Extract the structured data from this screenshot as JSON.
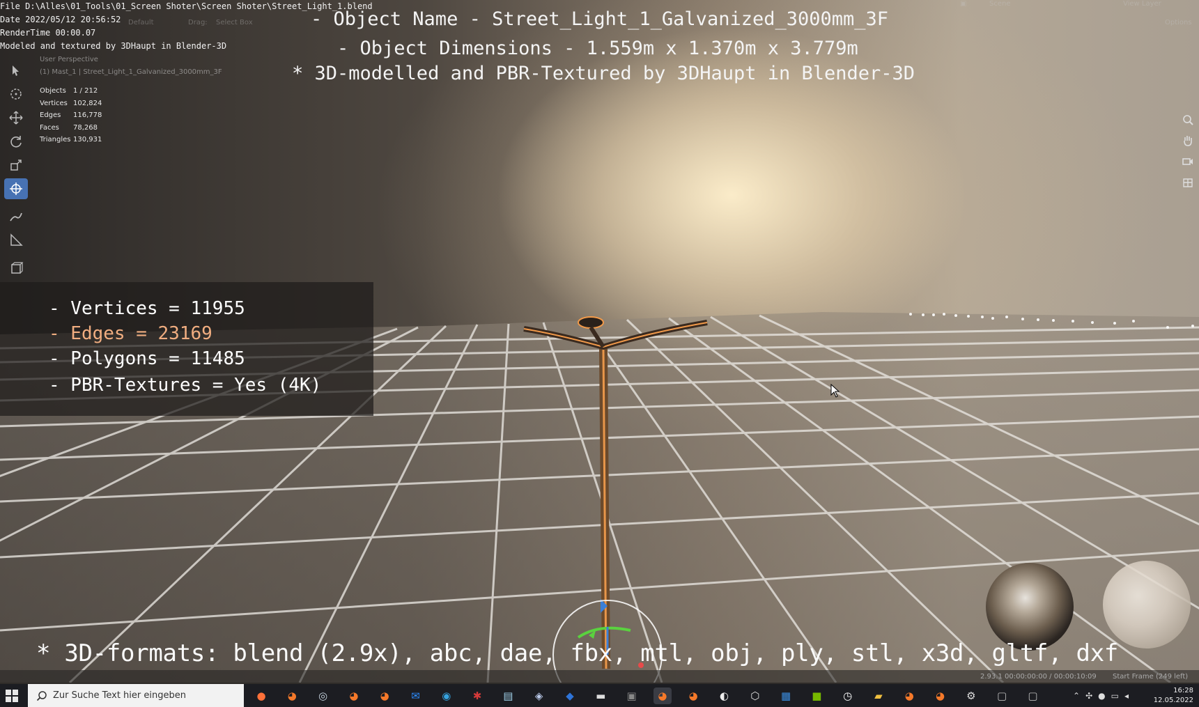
{
  "meta": {
    "file": "File D:\\Alles\\01_Tools\\01_Screen Shoter\\Screen Shoter\\Street_Light_1.blend",
    "date": "Date 2022/05/12 20:56:52",
    "render_time": "RenderTime 00:00.07",
    "credit": "Modeled and textured by 3DHaupt in Blender-3D"
  },
  "title_overlay": {
    "line1": "- Object Name - Street_Light_1_Galvanized_3000mm_3F",
    "line2": "- Object Dimensions -  1.559m x 1.370m x 3.779m",
    "line3": "* 3D-modelled and PBR-Textured by 3DHaupt in Blender-3D"
  },
  "header": {
    "scene": "Scene",
    "view_layer": "View Layer",
    "orientation": "Default",
    "drag_label": "Drag:",
    "drag_value": "Select Box",
    "options": "Options"
  },
  "viewport": {
    "perspective": "User Perspective",
    "active_object": "(1) Mast_1 | Street_Light_1_Galvanized_3000mm_3F"
  },
  "stats": [
    {
      "label": "Objects",
      "value": "1 / 212"
    },
    {
      "label": "Vertices",
      "value": "102,824"
    },
    {
      "label": "Edges",
      "value": "116,778"
    },
    {
      "label": "Faces",
      "value": "78,268"
    },
    {
      "label": "Triangles",
      "value": "130,931"
    }
  ],
  "mesh_info": {
    "vertices": "- Vertices = 11955",
    "edges": "- Edges = 23169",
    "polygons": "- Polygons = 11485",
    "pbr": "- PBR-Textures =  Yes (4K)"
  },
  "formats": "* 3D-formats: blend (2.9x), abc, dae, fbx, mtl, obj, ply, stl, x3d, gltf, dxf",
  "status_bar": {
    "version": "2.93.1  00:00:00:00 / 00:00:10:09",
    "frame": "Start Frame (249 left)"
  },
  "taskbar": {
    "search_placeholder": "Zur Suche Text hier eingeben",
    "apps": [
      "firefox-icon",
      "blender-icon",
      "steam-icon",
      "blender-icon",
      "blender-icon",
      "mail-icon",
      "edge-icon",
      "app-red-icon",
      "notes-icon",
      "app-icon",
      "dropbox-icon",
      "terminal-icon",
      "app-dark-icon",
      "blender-icon",
      "blender-icon",
      "panda-icon",
      "cube-icon",
      "calendar-icon",
      "nvidia-icon",
      "clock-app-icon",
      "folder-icon",
      "blender-icon",
      "blender-icon",
      "settings-icon",
      "app-gray-icon",
      "app-gray-icon"
    ],
    "time": "16:28",
    "date": "12.05.2022"
  },
  "colors": {
    "accent_blue": "#4772b3",
    "selection_orange": "#f0ad80"
  }
}
